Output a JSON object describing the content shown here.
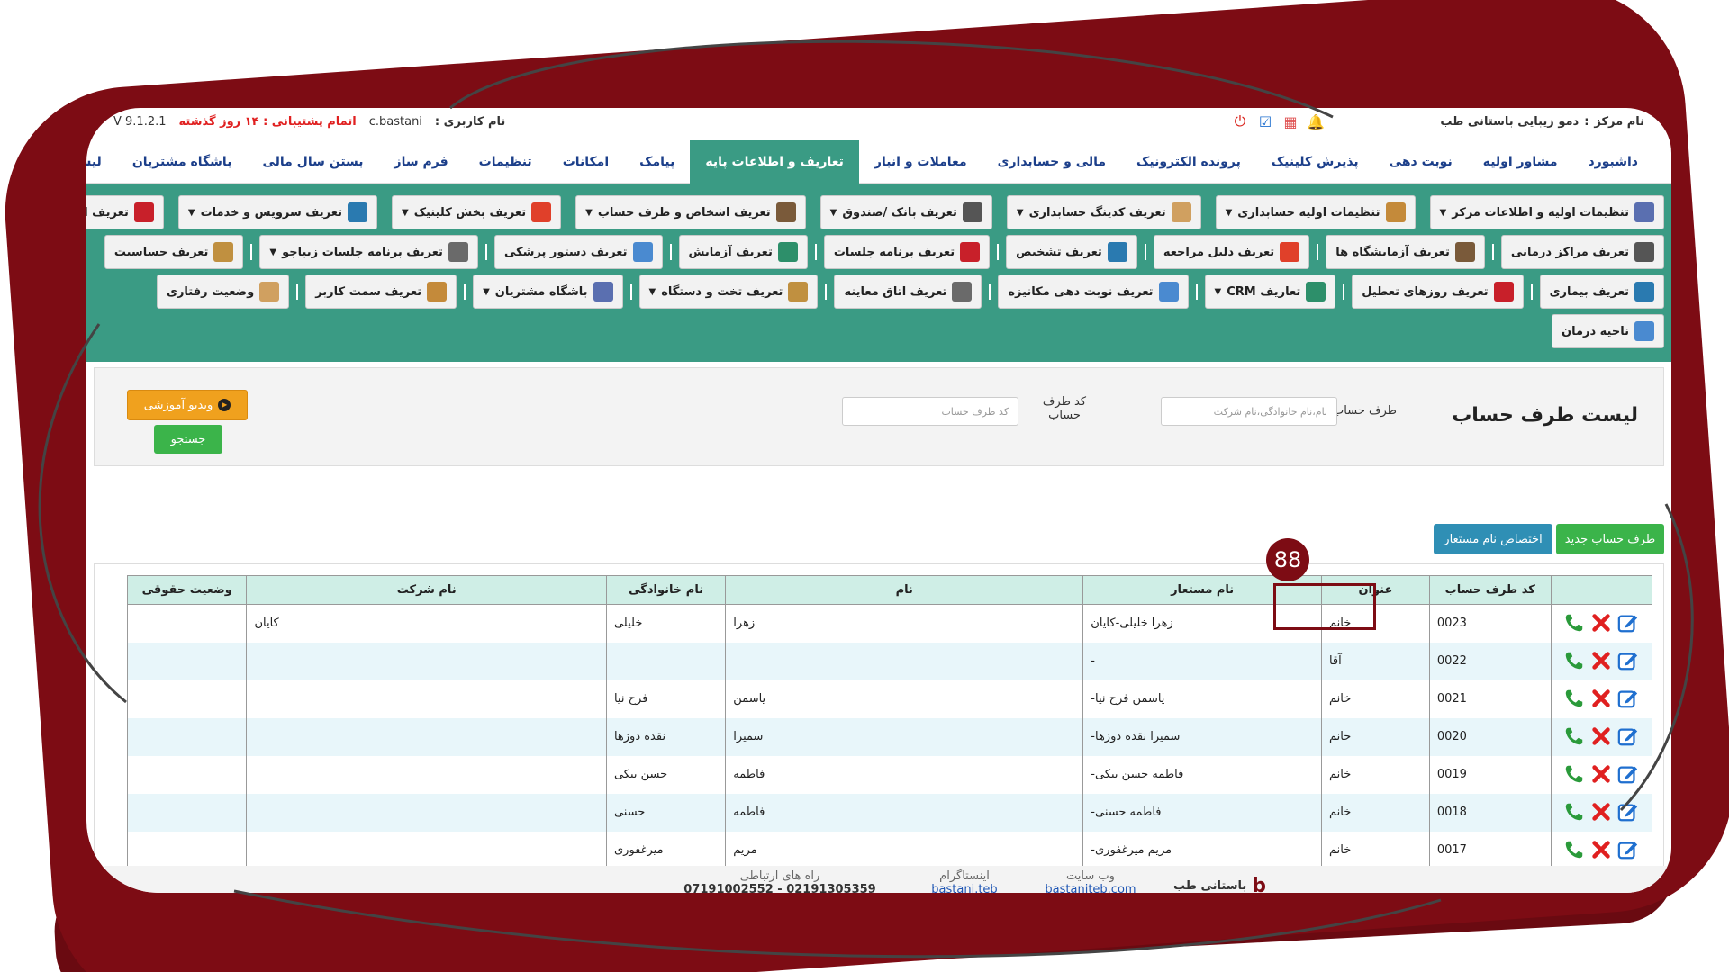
{
  "topbar": {
    "center_label": "نام مرکز",
    "center_name": "دمو زیبایی باستانی طب",
    "user_label": "نام کاربری :",
    "username": "c.bastani",
    "support_warning": "اتمام پشتیبانی : ۱۴ روز گذشته",
    "version": "V 9.1.2.1"
  },
  "mainnav": [
    "داشبورد",
    "مشاور اولیه",
    "نوبت دهی",
    "پذیرش کلینیک",
    "پرونده الکترونیک",
    "مالی و حسابداری",
    "معاملات و انبار",
    "تعاریف و اطلاعات پایه",
    "پیامک",
    "امکانات",
    "تنظیمات",
    "فرم ساز",
    "بستن سال مالی",
    "باشگاه مشتریان",
    "لیست ماژول ها"
  ],
  "mainnav_active": "تعاریف و اطلاعات پایه",
  "toolbar": {
    "row1": [
      "تنظیمات اولیه و اطلاعات مرکز",
      "تنظیمات اولیه حسابداری",
      "تعریف کدینگ حسابداری",
      "تعریف بانک /صندوق",
      "تعریف اشخاص و طرف حساب",
      "تعریف بخش کلینیک",
      "تعریف سرویس و خدمات",
      "تعریف انبار و کالا"
    ],
    "row2": [
      "تعریف مراکز درمانی",
      "تعریف آزمایشگاه ها",
      "تعریف دلیل مراجعه",
      "تعریف تشخیص",
      "تعریف برنامه جلسات",
      "تعریف آزمایش",
      "تعریف دستور پزشکی",
      "تعریف برنامه جلسات زیباجو",
      "تعریف حساسیت"
    ],
    "row3": [
      "تعریف بیماری",
      "تعریف روزهای تعطیل",
      "تعاریف CRM",
      "تعریف نوبت دهی مکانیزه",
      "تعریف اتاق معاینه",
      "تعریف تخت و دستگاه",
      "باشگاه مشتریان",
      "تعریف سمت کاربر",
      "وضعیت رفتاری"
    ],
    "row4": [
      "ناحیه درمان"
    ]
  },
  "search": {
    "title": "لیست طرف حساب",
    "party_label": "طرف حساب",
    "party_placeholder": "نام،نام خانوادگی،نام شرکت",
    "code_label": "کد طرف حساب",
    "code_placeholder": "کد طرف حساب",
    "video_label": "ویدیو آموزشی",
    "search_label": "جستجو"
  },
  "actions": {
    "new_party": "طرف حساب جدید",
    "assign_alias": "اختصاص نام مستعار"
  },
  "badge": "88",
  "table": {
    "headers": [
      "",
      "کد طرف حساب",
      "عنوان",
      "نام مستعار",
      "نام",
      "نام خانوادگی",
      "نام شرکت",
      "وضعیت حقوقی"
    ],
    "rows": [
      [
        "0023",
        "خانم",
        "زهرا خلیلی-کایان",
        "زهرا",
        "خلیلی",
        "کایان",
        ""
      ],
      [
        "0022",
        "آقا",
        "-",
        "",
        "",
        "",
        ""
      ],
      [
        "0021",
        "خانم",
        "یاسمن فرح نیا-",
        "یاسمن",
        "فرح نیا",
        "",
        ""
      ],
      [
        "0020",
        "خانم",
        "سمیرا نقده دوزها-",
        "سمیرا",
        "نقده دوزها",
        "",
        ""
      ],
      [
        "0019",
        "خانم",
        "فاطمه حسن بیکی-",
        "فاطمه",
        "حسن بیکی",
        "",
        ""
      ],
      [
        "0018",
        "خانم",
        "فاطمه حسنی-",
        "فاطمه",
        "حسنی",
        "",
        ""
      ],
      [
        "0017",
        "خانم",
        "مریم میرغفوری-",
        "مریم",
        "میرغفوری",
        "",
        ""
      ]
    ]
  },
  "footer": {
    "brand": "باستانی طب",
    "site_label": "وب سایت",
    "site": "bastaniteb.com",
    "insta_label": "اینستاگرام",
    "insta": "bastani.teb",
    "contact_label": "راه های ارتباطی",
    "phones": "07191002552 - 02191305359"
  },
  "colors": {
    "frame": "#7d0c14",
    "toolbar": "#3a9b84",
    "table_header": "#cfeee6",
    "nav_text": "#1c3f8a"
  }
}
